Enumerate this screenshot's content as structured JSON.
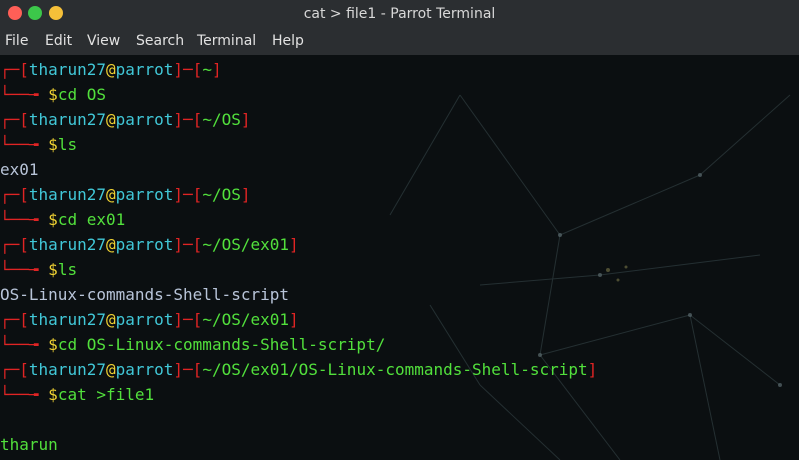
{
  "window": {
    "title": "cat > file1 - Parrot Terminal"
  },
  "menu": [
    "File",
    "Edit",
    "View",
    "Search",
    "Terminal",
    "Help"
  ],
  "terminal": {
    "user": "tharun27",
    "at": "@",
    "host": "parrot",
    "blocks": [
      {
        "path": "~",
        "command": "cd OS"
      },
      {
        "path": "~/OS",
        "command": "ls"
      },
      {
        "path": "~/OS",
        "command": "cd ex01"
      },
      {
        "path": "~/OS/ex01",
        "command": "ls"
      },
      {
        "path": "~/OS/ex01",
        "command": "cd OS-Linux-commands-Shell-script/"
      },
      {
        "path": "~/OS/ex01/OS-Linux-commands-Shell-script",
        "command": "cat >file1"
      }
    ],
    "outputs": [
      "ex01",
      "OS-Linux-commands-Shell-script",
      "tharun"
    ]
  },
  "colors": {
    "prompt_bracket": "#e02424",
    "user": "#41c8d8",
    "at": "#f0d232",
    "host": "#41c8d8",
    "command": "#52e03c",
    "dollar": "#f0d232",
    "output": "#b8c4d8",
    "background": "#0b0f11"
  }
}
